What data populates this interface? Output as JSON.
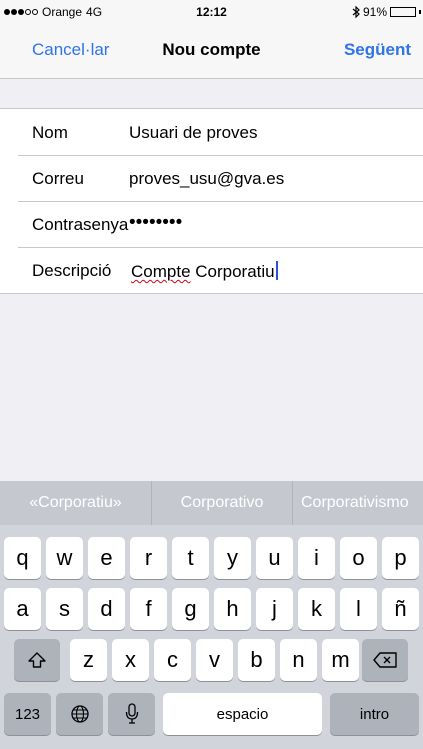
{
  "status_bar": {
    "carrier": "Orange",
    "network": "4G",
    "time": "12:12",
    "bluetooth_icon": "bluetooth-icon",
    "battery": "91%",
    "battery_level": 0.91
  },
  "nav": {
    "cancel": "Cancel·lar",
    "title": "Nou compte",
    "next": "Següent"
  },
  "form": {
    "name_label": "Nom",
    "name_value": "Usuari de proves",
    "email_label": "Correu",
    "email_value": "proves_usu@gva.es",
    "password_label": "Contrasenya",
    "password_value": "••••••••",
    "description_label": "Descripció",
    "description_word1": "Compte",
    "description_word2": " Corporatiu"
  },
  "suggestions": [
    "«Corporatiu»",
    "Corporativo",
    "Corporativismo"
  ],
  "keyboard": {
    "row1": [
      "q",
      "w",
      "e",
      "r",
      "t",
      "y",
      "u",
      "i",
      "o",
      "p"
    ],
    "row2": [
      "a",
      "s",
      "d",
      "f",
      "g",
      "h",
      "j",
      "k",
      "l",
      "ñ"
    ],
    "row3": [
      "z",
      "x",
      "c",
      "v",
      "b",
      "n",
      "m"
    ],
    "numbers": "123",
    "space": "espacio",
    "return": "intro",
    "icons": {
      "shift": "shift-icon",
      "backspace": "backspace-icon",
      "globe": "globe-icon",
      "mic": "microphone-icon"
    }
  },
  "colors": {
    "accent": "#2f74e8",
    "keyboard_bg": "#d1d4da",
    "suggest_bg": "#c5c8ce"
  }
}
